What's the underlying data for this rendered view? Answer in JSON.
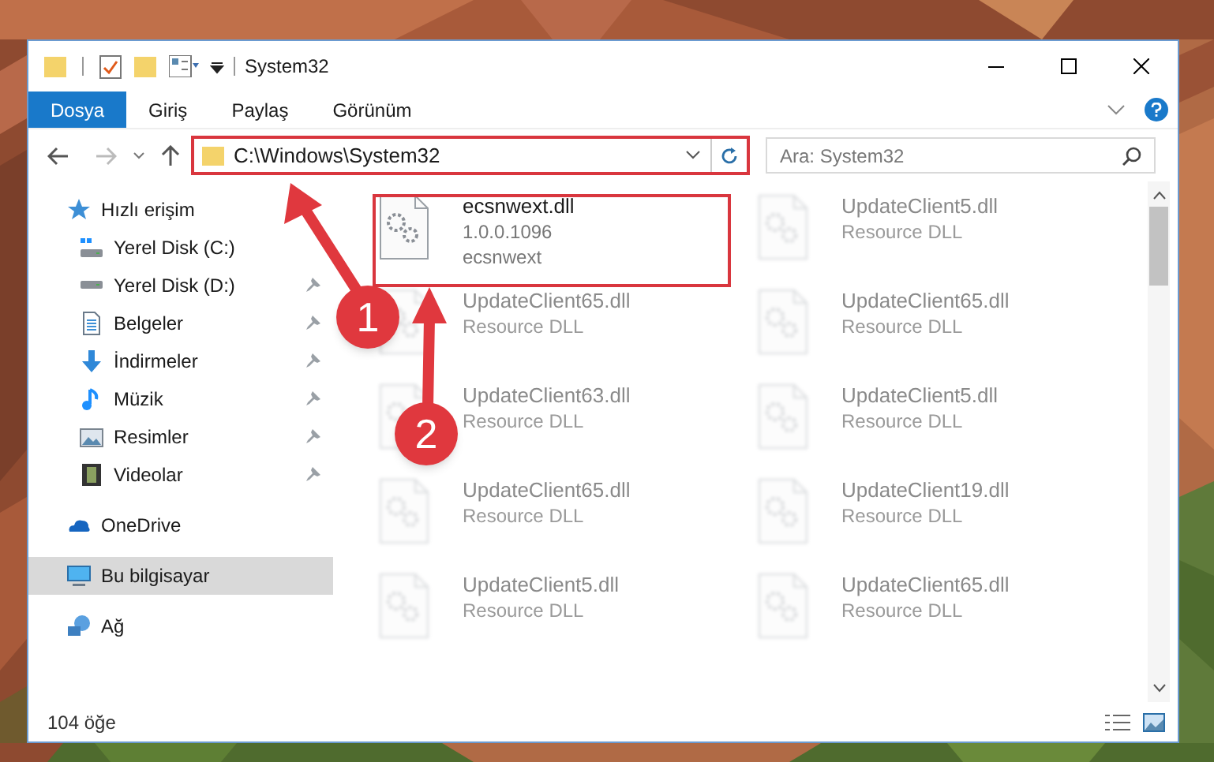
{
  "window": {
    "title": "System32"
  },
  "ribbon_tabs": [
    {
      "label": "Dosya",
      "selected": true
    },
    {
      "label": "Giriş",
      "selected": false
    },
    {
      "label": "Paylaş",
      "selected": false
    },
    {
      "label": "Görünüm",
      "selected": false
    }
  ],
  "address": {
    "value": "C:\\Windows\\System32"
  },
  "search": {
    "placeholder": "Ara: System32"
  },
  "sidebar": {
    "items": [
      {
        "label": "Hızlı erişim",
        "kind": "star",
        "pinned": false,
        "selected": false,
        "children": [
          {
            "label": "Yerel Disk (C:)",
            "kind": "systemdrive",
            "pinned": false,
            "selected": false
          },
          {
            "label": "Yerel Disk (D:)",
            "kind": "drive",
            "pinned": true,
            "selected": false
          },
          {
            "label": "Belgeler",
            "kind": "documents",
            "pinned": true,
            "selected": false
          },
          {
            "label": "İndirmeler",
            "kind": "downloads",
            "pinned": true,
            "selected": false
          },
          {
            "label": "Müzik",
            "kind": "music",
            "pinned": true,
            "selected": false
          },
          {
            "label": "Resimler",
            "kind": "pictures",
            "pinned": true,
            "selected": false
          },
          {
            "label": "Videolar",
            "kind": "videos",
            "pinned": true,
            "selected": false
          }
        ]
      },
      {
        "label": "OneDrive",
        "kind": "cloud",
        "pinned": false,
        "selected": false
      },
      {
        "label": "Bu bilgisayar",
        "kind": "computer",
        "pinned": false,
        "selected": true
      },
      {
        "label": "Ağ",
        "kind": "network",
        "pinned": false,
        "selected": false
      }
    ]
  },
  "files": [
    {
      "name": "ecsnwext.dll",
      "version": "1.0.0.1096",
      "description": "ecsnwext",
      "blurred": false
    },
    {
      "name": "UpdateClient5.dll",
      "description": "Resource DLL",
      "blurred": true
    },
    {
      "name": "UpdateClient65.dll",
      "description": "Resource DLL",
      "blurred": true
    },
    {
      "name": "UpdateClient65.dll",
      "description": "Resource DLL",
      "blurred": true
    },
    {
      "name": "UpdateClient63.dll",
      "description": "Resource DLL",
      "blurred": true
    },
    {
      "name": "UpdateClient5.dll",
      "description": "Resource DLL",
      "blurred": true
    },
    {
      "name": "UpdateClient65.dll",
      "description": "Resource DLL",
      "blurred": true
    },
    {
      "name": "UpdateClient19.dll",
      "description": "Resource DLL",
      "blurred": true
    },
    {
      "name": "UpdateClient5.dll",
      "description": "Resource DLL",
      "blurred": true
    },
    {
      "name": "UpdateClient65.dll",
      "description": "Resource DLL",
      "blurred": true
    }
  ],
  "status_bar": {
    "count": "104 öğe"
  },
  "annotations": [
    {
      "label": "1"
    },
    {
      "label": "2"
    }
  ]
}
